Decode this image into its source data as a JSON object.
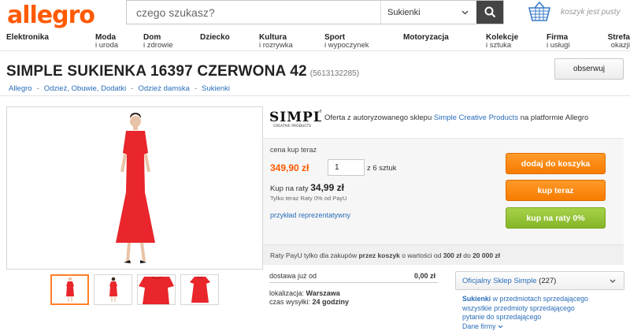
{
  "header": {
    "logo": "allegro",
    "search_placeholder": "czego szukasz?",
    "category": "Sukienki",
    "basket_text": "koszyk jest pusty"
  },
  "nav": [
    {
      "title": "Elektronika",
      "sub": ""
    },
    {
      "title": "Moda",
      "sub": "i uroda"
    },
    {
      "title": "Dom",
      "sub": "i zdrowie"
    },
    {
      "title": "Dziecko",
      "sub": ""
    },
    {
      "title": "Kultura",
      "sub": "i rozrywka"
    },
    {
      "title": "Sport",
      "sub": "i wypoczynek"
    },
    {
      "title": "Motoryzacja",
      "sub": ""
    },
    {
      "title": "Kolekcje",
      "sub": "i sztuka"
    },
    {
      "title": "Firma",
      "sub": "i usługi"
    },
    {
      "title": "Strefa",
      "sub": "okazji"
    }
  ],
  "product": {
    "title": "SIMPLE SUKIENKA 16397 CZERWONA 42",
    "id": "(5613132285)",
    "observe": "obserwuj"
  },
  "breadcrumbs": [
    "Allegro",
    "Odzież, Obuwie, Dodatki",
    "Odzież damska",
    "Sukienki"
  ],
  "seller": {
    "logo_text": "SIMPLE",
    "logo_sub": "CREATIVE PRODUCTS",
    "text_before": "Oferta z autoryzowanego sklepu ",
    "shop_name": "Simple Creative Products",
    "text_after": " na platformie Allegro"
  },
  "buy": {
    "price_label": "cena kup teraz",
    "price": "349,90 zł",
    "quantity": "1",
    "of_text": "z 6 sztuk",
    "raty_label": "Kup na raty",
    "raty_value": "34,99 zł",
    "raty_sub": "Tylko teraz Raty 0% od PayU",
    "raty_link": "przykład reprezentatywny",
    "btn_cart": "dodaj do koszyka",
    "btn_buy": "kup teraz",
    "btn_raty": "kup na raty 0%",
    "payu_pre": "Raty PayU tylko dla zakupów ",
    "payu_bold1": "przez koszyk",
    "payu_mid": " o wartości od ",
    "payu_bold2": "300 zł",
    "payu_and": " do ",
    "payu_bold3": "20 000 zł"
  },
  "delivery": {
    "label": "dostawa już od",
    "value": "0,00 zł",
    "loc_label": "lokalizacja:",
    "loc_value": "Warszawa",
    "ship_label": "czas wysyłki:",
    "ship_value": "24 godziny"
  },
  "shop": {
    "official_label": "Oficjalny Sklep Simple",
    "count": "(227)",
    "link1_bold": "Sukienki",
    "link1_rest": " w przedmiotach sprzedającego",
    "link2": "wszystkie przedmioty sprzedającego",
    "link3": "pytanie do sprzedającego",
    "link4": "Dane firmy"
  },
  "colors": {
    "brand": "#ff5a00",
    "link": "#2a6db8",
    "buy_button": "#f77c00",
    "raty_button": "#86b528",
    "dress": "#e8262b"
  }
}
